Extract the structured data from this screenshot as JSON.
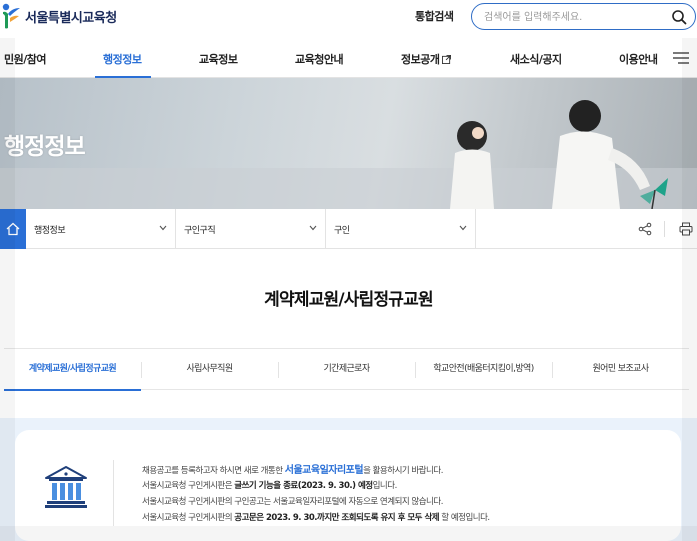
{
  "header": {
    "logo_text": "서울특별시교육청",
    "total_search_label": "통합검색",
    "search_placeholder": "검색어를 입력해주세요."
  },
  "nav": {
    "items": [
      {
        "label": "민원/참여"
      },
      {
        "label": "행정정보",
        "active": true
      },
      {
        "label": "교육정보"
      },
      {
        "label": "교육청안내"
      },
      {
        "label": "정보공개",
        "external": true
      },
      {
        "label": "새소식/공지"
      },
      {
        "label": "이용안내"
      }
    ]
  },
  "hero": {
    "title": "행정정보"
  },
  "breadcrumb": {
    "items": [
      {
        "label": "행정정보"
      },
      {
        "label": "구인구직"
      },
      {
        "label": "구인"
      }
    ]
  },
  "page": {
    "title": "계약제교원/사립정규교원"
  },
  "subtabs": [
    {
      "label": "계약제교원/사립정규교원",
      "active": true
    },
    {
      "label": "사립사무직원"
    },
    {
      "label": "기간제근로자"
    },
    {
      "label": "학교안전(배움터지킴이,방역)"
    },
    {
      "label": "원어민 보조교사"
    }
  ],
  "notice": {
    "line1_pre": "채용공고를 등록하고자 하시면 새로 개통한 ",
    "line1_portal": "서울교육일자리포털",
    "line1_post": "을 활용하시기 바랍니다.",
    "line2_pre": "서울시교육청 구인게시판은 ",
    "line2_bold": "글쓰기 기능을 종료(2023. 9. 30.) 예정",
    "line2_post": "입니다.",
    "line3": "서울시교육청 구인게시판의 구인공고는 서울교육일자리포털에 자동으로 연계되지 않습니다.",
    "line4_pre": "서울시교육청 구인게시판의 ",
    "line4_bold": "공고문은 2023. 9. 30.까지만 조회되도록 유지 후 모두 삭제",
    "line4_post": " 할 예정입니다."
  },
  "colors": {
    "accent": "#2a6fd6",
    "notice_bg": "#eaf2fb"
  }
}
